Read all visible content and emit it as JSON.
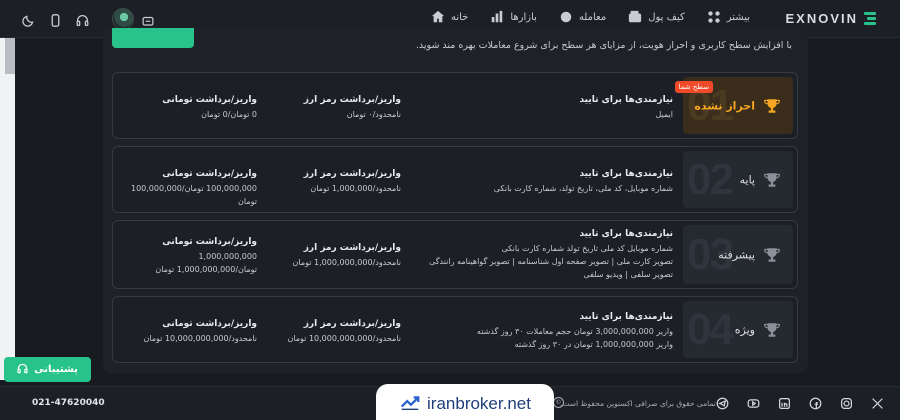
{
  "brand": {
    "name": "EXNOVIN",
    "accent": "#28c28b"
  },
  "nav": [
    {
      "label": "خانه",
      "icon": "home-icon"
    },
    {
      "label": "بازارها",
      "icon": "bar-chart-icon"
    },
    {
      "label": "معامله",
      "icon": "trade-icon"
    },
    {
      "label": "کیف پول",
      "icon": "wallet-icon"
    },
    {
      "label": "بیشتر",
      "icon": "grid-icon"
    }
  ],
  "header_tools": [
    "moon-icon",
    "mobile-icon",
    "headset-icon",
    "message-icon"
  ],
  "intro": "با افزایش سطح کاربری و احراز هویت، از مزایای هر سطح برای شروع معاملات بهره مند شوید.",
  "levels": [
    {
      "number": "01",
      "name": "احراز نشده",
      "current_tag": "سطح شما",
      "active": true,
      "requirements_title": "نیازمندی‌ها برای تایید",
      "requirements": [
        "ایمیل"
      ],
      "crypto_title": "واریز/برداشت رمز ارز",
      "crypto_value": "نامحدود/۰ تومان",
      "toman_title": "واریز/برداشت تومانی",
      "toman_value": "0 تومان/0 تومان"
    },
    {
      "number": "02",
      "name": "پایه",
      "active": false,
      "requirements_title": "نیازمندی‌ها برای تایید",
      "requirements": [
        "شماره موبایل، کد ملی، تاریخ تولد، شماره کارت بانکی"
      ],
      "crypto_title": "واریز/برداشت رمز ارز",
      "crypto_value": "نامحدود/1,000,000 تومان",
      "toman_title": "واریز/برداشت تومانی",
      "toman_value": "100,000,000 تومان/100,000,000 تومان"
    },
    {
      "number": "03",
      "name": "پیشرفته",
      "active": false,
      "requirements_title": "نیازمندی‌ها برای تایید",
      "requirements": [
        "شماره موبایل کد ملی تاریخ تولد شماره کارت بانکی",
        "تصویر کارت ملی | تصویر صفحه اول شناسنامه | تصویر گواهینامه رانندگی",
        "تصویر سلفی | ویدیو سلفی"
      ],
      "crypto_title": "واریز/برداشت رمز ارز",
      "crypto_value": "نامحدود/1,000,000,000 تومان",
      "toman_title": "واریز/برداشت تومانی",
      "toman_value": "1,000,000,000 تومان/1,000,000,000 تومان"
    },
    {
      "number": "04",
      "name": "ویژه",
      "active": false,
      "requirements_title": "نیازمندی‌ها برای تایید",
      "requirements": [
        "واریز 3,000,000,000 تومان حجم معاملات ۳۰ روز گذشته",
        "واریز 1,000,000,000 تومان در ۳۰ روز گذشته"
      ],
      "crypto_title": "واریز/برداشت رمز ارز",
      "crypto_value": "نامحدود/10,000,000,000 تومان",
      "toman_title": "واریز/برداشت تومانی",
      "toman_value": "نامحدود/10,000,000,000 تومان"
    }
  ],
  "support_label": "پشتیبانی",
  "footer": {
    "phone": "021-47620040",
    "copyright": "تمامی حقوق برای صرافی اکسنوین محفوظ است.",
    "socials": [
      "x-icon",
      "instagram-icon",
      "facebook-icon",
      "linkedin-icon",
      "youtube-icon",
      "telegram-icon"
    ]
  },
  "watermark": "iranbroker.net"
}
